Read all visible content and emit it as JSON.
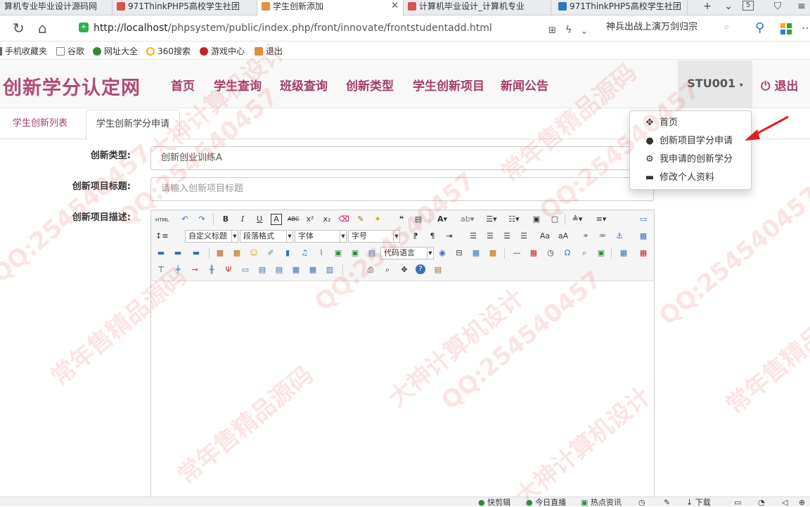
{
  "browser": {
    "tabs": [
      {
        "title": "算机专业毕业设计源码网",
        "active": false,
        "fav": "#d9534f"
      },
      {
        "title": "971ThinkPHP5高校学生社团",
        "active": false,
        "fav": "#d9534f"
      },
      {
        "title": "学生创新添加",
        "active": true,
        "fav": "#e0913b"
      },
      {
        "title": "计算机毕业设计_计算机专业",
        "active": false,
        "fav": "#d9534f"
      },
      {
        "title": "971ThinkPHP5高校学生社团",
        "active": false,
        "fav": "#2f74c0"
      }
    ],
    "tab_count": "5",
    "url_host": "http://localhost",
    "url_path": "/phpsystem/public/index.php/front/innovate/frontstudentadd.html",
    "search_text": "神兵出战上演万剑归宗",
    "bookmarks": [
      "手机收藏夹",
      "谷歌",
      "网址大全",
      "360搜索",
      "游戏中心",
      "退出"
    ]
  },
  "site": {
    "brand": "创新学分认定网",
    "nav": [
      "首页",
      "学生查询",
      "班级查询",
      "创新类型",
      "学生创新项目",
      "新闻公告"
    ],
    "user": "STU001",
    "logout": "退出",
    "accent": "#a53e6c"
  },
  "subtabs": [
    "学生创新列表",
    "学生创新学分申请"
  ],
  "form": {
    "type_label": "创新类型:",
    "type_value": "创新创业训练A",
    "title_label": "创新项目标题:",
    "title_placeholder": "请输入创新项目标题",
    "desc_label": "创新项目描述:"
  },
  "editor": {
    "custom_title": "自定义标题",
    "paragraph": "段落格式",
    "font": "字体",
    "font_size": "字号",
    "code_lang": "代码语言"
  },
  "dropdown": [
    {
      "label": "首页",
      "icon": "move-icon"
    },
    {
      "label": "创新项目学分申请",
      "icon": "user-icon"
    },
    {
      "label": "我申请的创新学分",
      "icon": "gear-icon"
    },
    {
      "label": "修改个人资料",
      "icon": "card-icon"
    }
  ],
  "statusbar": [
    "快剪辑",
    "今日直播",
    "热点资讯",
    "下载"
  ],
  "watermark": [
    "QQ:254540457",
    "常年售精品源码",
    "大神计算机设计"
  ]
}
